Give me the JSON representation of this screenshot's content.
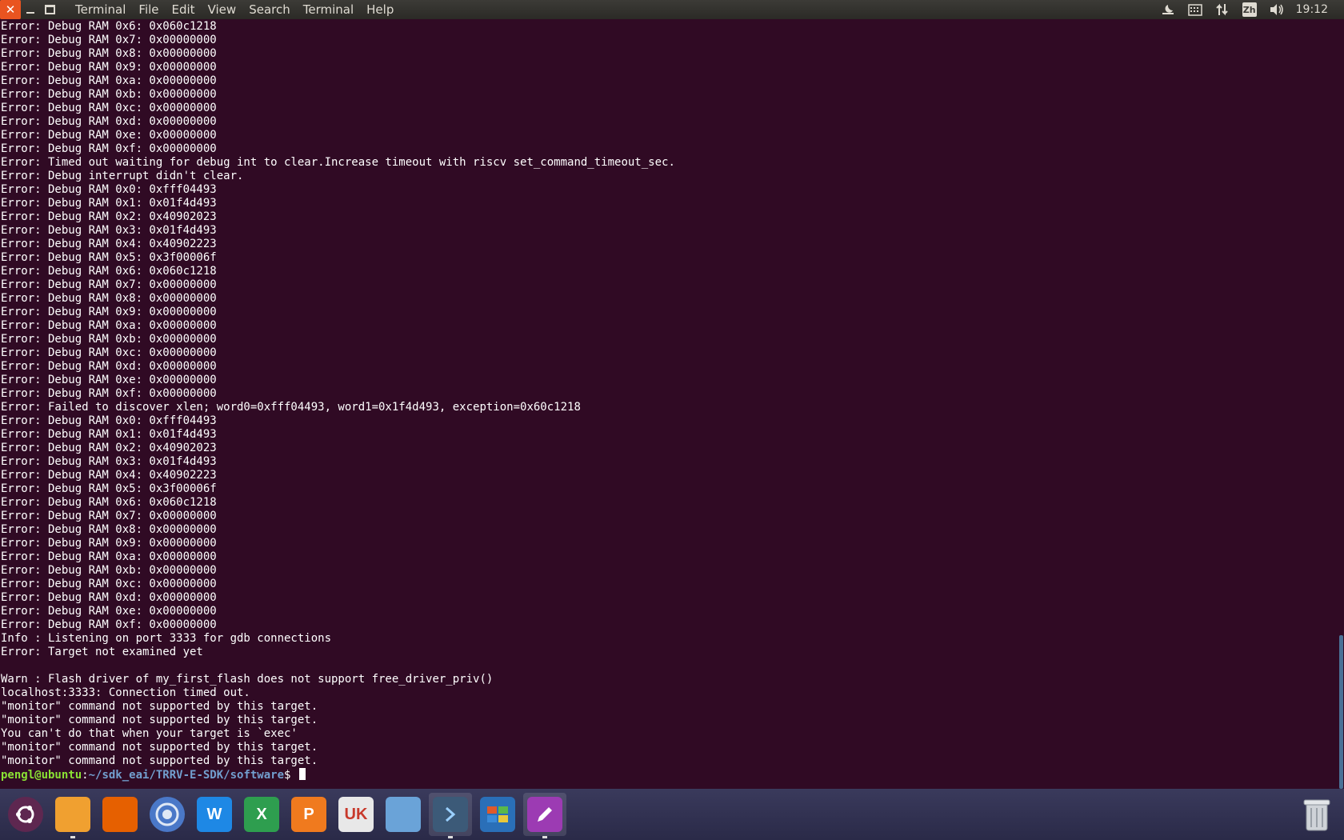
{
  "window": {
    "close_glyph": "✕",
    "menu": [
      "Terminal",
      "File",
      "Edit",
      "View",
      "Search",
      "Terminal",
      "Help"
    ]
  },
  "tray": {
    "input_method": "Zh",
    "clock": "19:12",
    "icons": [
      "night-settings-icon",
      "keyboard-icon",
      "network-arrows-icon",
      "input-method-icon",
      "volume-icon"
    ]
  },
  "terminal": {
    "lines": [
      "Error: Debug RAM 0x6: 0x060c1218",
      "Error: Debug RAM 0x7: 0x00000000",
      "Error: Debug RAM 0x8: 0x00000000",
      "Error: Debug RAM 0x9: 0x00000000",
      "Error: Debug RAM 0xa: 0x00000000",
      "Error: Debug RAM 0xb: 0x00000000",
      "Error: Debug RAM 0xc: 0x00000000",
      "Error: Debug RAM 0xd: 0x00000000",
      "Error: Debug RAM 0xe: 0x00000000",
      "Error: Debug RAM 0xf: 0x00000000",
      "Error: Timed out waiting for debug int to clear.Increase timeout with riscv set_command_timeout_sec.",
      "Error: Debug interrupt didn't clear.",
      "Error: Debug RAM 0x0: 0xfff04493",
      "Error: Debug RAM 0x1: 0x01f4d493",
      "Error: Debug RAM 0x2: 0x40902023",
      "Error: Debug RAM 0x3: 0x01f4d493",
      "Error: Debug RAM 0x4: 0x40902223",
      "Error: Debug RAM 0x5: 0x3f00006f",
      "Error: Debug RAM 0x6: 0x060c1218",
      "Error: Debug RAM 0x7: 0x00000000",
      "Error: Debug RAM 0x8: 0x00000000",
      "Error: Debug RAM 0x9: 0x00000000",
      "Error: Debug RAM 0xa: 0x00000000",
      "Error: Debug RAM 0xb: 0x00000000",
      "Error: Debug RAM 0xc: 0x00000000",
      "Error: Debug RAM 0xd: 0x00000000",
      "Error: Debug RAM 0xe: 0x00000000",
      "Error: Debug RAM 0xf: 0x00000000",
      "Error: Failed to discover xlen; word0=0xfff04493, word1=0x1f4d493, exception=0x60c1218",
      "Error: Debug RAM 0x0: 0xfff04493",
      "Error: Debug RAM 0x1: 0x01f4d493",
      "Error: Debug RAM 0x2: 0x40902023",
      "Error: Debug RAM 0x3: 0x01f4d493",
      "Error: Debug RAM 0x4: 0x40902223",
      "Error: Debug RAM 0x5: 0x3f00006f",
      "Error: Debug RAM 0x6: 0x060c1218",
      "Error: Debug RAM 0x7: 0x00000000",
      "Error: Debug RAM 0x8: 0x00000000",
      "Error: Debug RAM 0x9: 0x00000000",
      "Error: Debug RAM 0xa: 0x00000000",
      "Error: Debug RAM 0xb: 0x00000000",
      "Error: Debug RAM 0xc: 0x00000000",
      "Error: Debug RAM 0xd: 0x00000000",
      "Error: Debug RAM 0xe: 0x00000000",
      "Error: Debug RAM 0xf: 0x00000000",
      "Info : Listening on port 3333 for gdb connections",
      "Error: Target not examined yet",
      "",
      "Warn : Flash driver of my_first_flash does not support free_driver_priv()",
      "localhost:3333: Connection timed out.",
      "\"monitor\" command not supported by this target.",
      "\"monitor\" command not supported by this target.",
      "You can't do that when your target is `exec'",
      "\"monitor\" command not supported by this target.",
      "\"monitor\" command not supported by this target."
    ],
    "prompt": {
      "user_host": "pengl@ubuntu",
      "sep": ":",
      "path": "~/sdk_eai/TRRV-E-SDK/software",
      "symbol": "$ "
    }
  },
  "dock": {
    "items": [
      {
        "name": "ubuntu-dash-icon",
        "label": "",
        "color": "#5e2750"
      },
      {
        "name": "files-icon",
        "label": "",
        "color": "#f0a030"
      },
      {
        "name": "firefox-icon",
        "label": "",
        "color": "#e66000"
      },
      {
        "name": "chromium-icon",
        "label": "",
        "color": "#4a78c8"
      },
      {
        "name": "wps-writer-icon",
        "label": "W",
        "color": "#1e88e5"
      },
      {
        "name": "wps-spreadsheets-icon",
        "label": "X",
        "color": "#2e9e4f"
      },
      {
        "name": "wps-presentation-icon",
        "label": "P",
        "color": "#f07a1e"
      },
      {
        "name": "software-center-icon",
        "label": "UK",
        "color": "#e8e8e8"
      },
      {
        "name": "remote-desktop-icon",
        "label": "",
        "color": "#6aa3d8"
      },
      {
        "name": "terminal-app-icon",
        "label": "",
        "color": "#3c5a78"
      },
      {
        "name": "workspace-switcher-icon",
        "label": "",
        "color": "#2a6fb8"
      },
      {
        "name": "text-editor-icon",
        "label": "",
        "color": "#9c3bb3"
      }
    ],
    "trash_label": ""
  }
}
